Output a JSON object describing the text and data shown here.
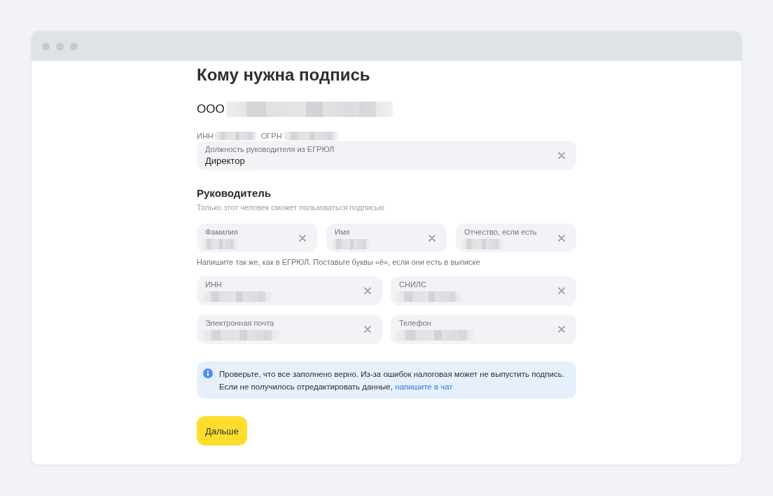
{
  "page": {
    "title": "Кому нужна подпись"
  },
  "company": {
    "prefix": "ООО",
    "name_redacted": true,
    "ids": [
      {
        "label": "ИНН",
        "redacted": true
      },
      {
        "label": "ОГРН",
        "redacted": true
      }
    ]
  },
  "position_field": {
    "label": "Должность руководителя из ЕГРЮЛ",
    "value": "Директор",
    "redacted": false
  },
  "section": {
    "title": "Руководитель",
    "subtitle": "Только этот человек сможет пользоваться подписью"
  },
  "name_fields": [
    {
      "label": "Фамилия",
      "redacted": true
    },
    {
      "label": "Имя",
      "redacted": true
    },
    {
      "label": "Отчество, если есть",
      "redacted": true
    }
  ],
  "name_hint": "Напишите так же, как в ЕГРЮЛ. Поставьте буквы «ё», если они есть в выписке",
  "contact_fields": [
    {
      "label": "ИНН",
      "redacted": true
    },
    {
      "label": "СНИЛС",
      "redacted": true
    },
    {
      "label": "Электронная почта",
      "redacted": true
    },
    {
      "label": "Телефон",
      "redacted": true
    }
  ],
  "notice": {
    "lines": [
      "Проверьте, что все заполнено верно. Из-за ошибок налоговая может не выпустить подпись.",
      "Если не получилось отредактировать данные,"
    ],
    "link": "напишите в чат"
  },
  "buttons": [
    {
      "label": "Дальше"
    }
  ]
}
